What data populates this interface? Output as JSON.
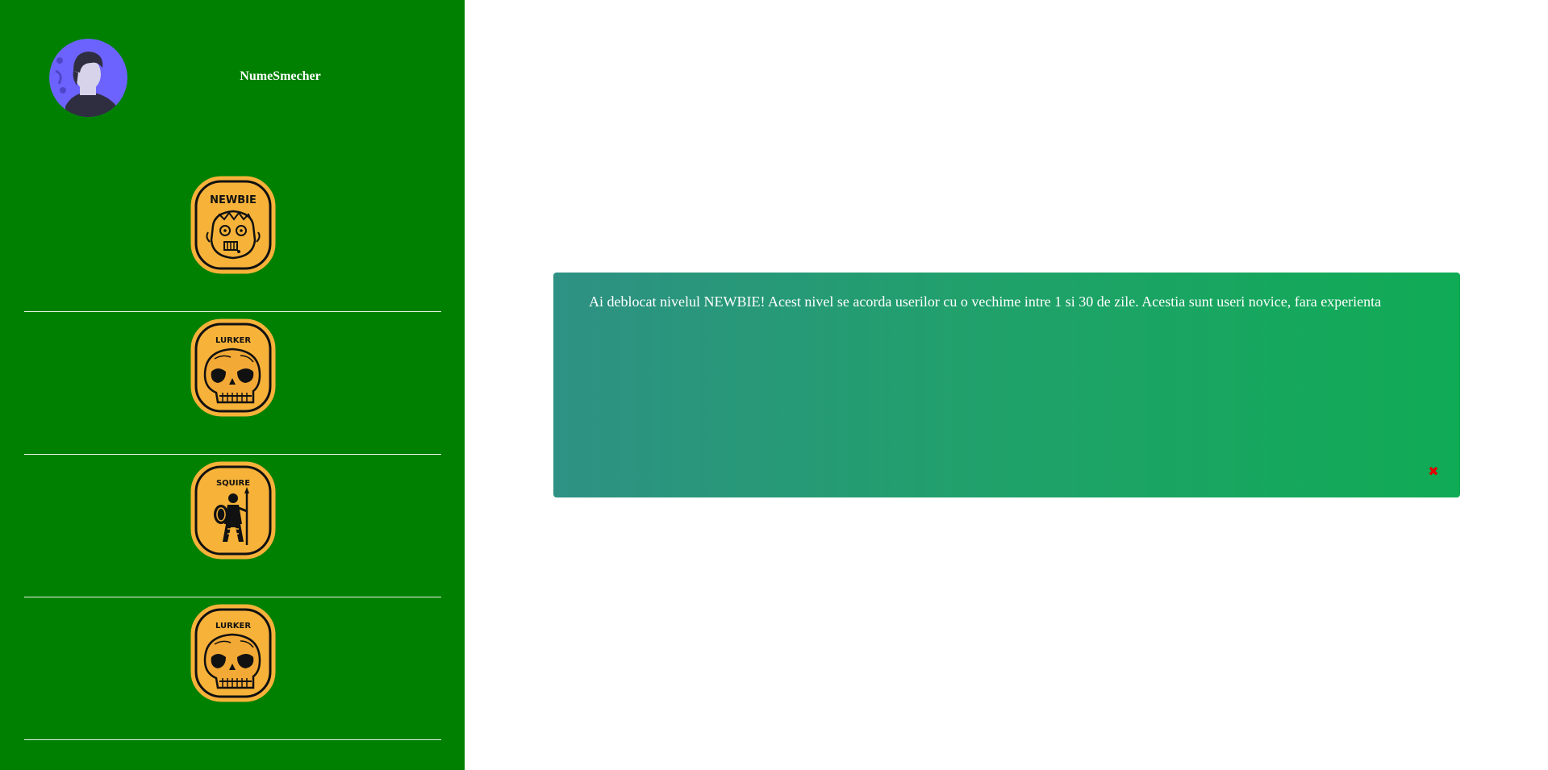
{
  "user": {
    "name": "NumeSmecher",
    "avatar_icon": "person-avatar-icon",
    "avatar_bg": "#6c63ff"
  },
  "badges": [
    {
      "label": "NEWBIE",
      "icon": "zombie-face-icon"
    },
    {
      "label": "LURKER",
      "icon": "skull-icon"
    },
    {
      "label": "SQUIRE",
      "icon": "warrior-icon"
    },
    {
      "label": "LURKER",
      "icon": "skull-icon"
    }
  ],
  "notice": {
    "message": "Ai deblocat nivelul NEWBIE! Acest nivel se acorda userilor cu o vechime intre 1 si 30 de zile. Acestia sunt useri novice, fara experienta",
    "close_symbol": "✖"
  },
  "colors": {
    "sidebar_bg": "#008000",
    "badge_fill": "#f7b239",
    "notice_gradient_start": "#2e9184",
    "notice_gradient_end": "#10ab55",
    "close_color": "#e00000"
  }
}
